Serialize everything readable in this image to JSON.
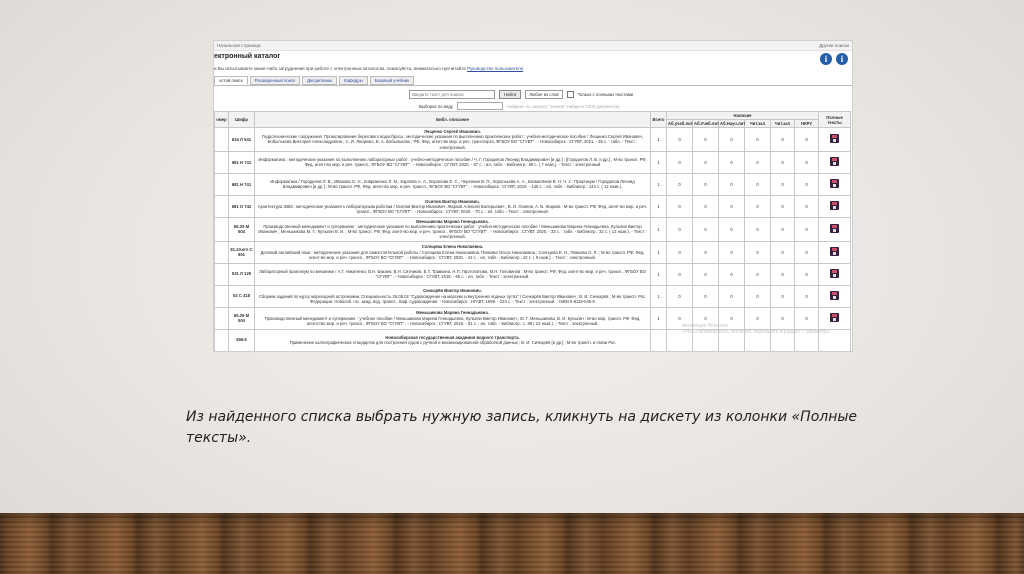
{
  "browser": {
    "page_label": "Начальная страница",
    "right_link": "Другие поиски"
  },
  "catalog": {
    "title": "ектронный каталог",
    "info_icon_label": "i",
    "notice_text": "и Вы испытываете какие-либо затруднения при работе с электронным каталогом, пожалуйста, внимательно прочитайте",
    "notice_link": "Руководство пользователя",
    "tabs": [
      "остой поиск",
      "Расширенный поиск",
      "Дисциплины",
      "Кафедры",
      "Базовый учебник"
    ],
    "search": {
      "placeholder": "Введите текст для поиска",
      "button": "Найти",
      "mode": "Любое из слов",
      "fulltext_label": "Только с полными текстами"
    },
    "filter": {
      "label": "Выборка по виду",
      "hint": "Найдено по запросу \"знания\" Найдено 1200 документов"
    },
    "table": {
      "headers": {
        "num": "омер",
        "shelf": "Шифр",
        "desc": "Библ. описание",
        "total": "Всего",
        "availability": "Наличие",
        "fulltext": "Полные тексты"
      },
      "sub_headers": [
        "Аб.учеб.лит",
        "Аб.Учеб.лит",
        "Аб.Науч.лит",
        "Чит.зал",
        "Чит.зал",
        "НКРУ"
      ],
      "rows": [
        {
          "shelf": "624 Л 541",
          "head": "Лещенко Сергей Иванович.",
          "text": "Гидротехнические сооружения. Проектирование берегового водосброса : методические указания по выполнению практических работ : учебно-методическое пособие / Лещенко Сергей Иванович, Бобылькова Виктория Александровна ; С. И. Лещенко, В. А. Бобылькова ; РФ, Фед. агент-во мор. и реч. транспорта, ФГБОУ ВО \"СГУВТ\" . - Новосибирск : СГУВТ, 2021. - 35 с. : табл. - Текст : электронный.",
          "total": "1",
          "counts": [
            "0",
            "0",
            "0",
            "0",
            "0",
            "0"
          ]
        },
        {
          "shelf": "681 Н 741",
          "head": "",
          "text": "Информатика : методические указания по выполнению лабораторных работ : учебно-методическое пособие / Ч. Г. Городилов Леонид Владимирович [и др.] ; [Городилов Л. В. и др.] ; М-во трансп. РФ, Фед. агент-во мор. и реч. трансп., ФГБОУ ВО \"СГУВТ\" . - Новосибирск : СГУВТ, 2020. - 67 с. : ил, табл. - Библиогр.: 86 с. ( 7 назв.). - Текст : электронный",
          "total": "1",
          "counts": [
            "0",
            "0",
            "0",
            "0",
            "0",
            "0"
          ]
        },
        {
          "shelf": "681 Н 741",
          "head": "",
          "text": "Информатика / Городилов Л. В., Иванова О. Н., Ковриженко Л. М., Карпова А. А., Воронова Е. С., Черепнин В. П., Королькова А. А., Безмолвнов В. Н. Ч. 2 : Практикум / Городилов Леонид Владимирович [и др.] ; М-во трансп. РФ, Фед. агент-во мор. и реч. трансп., ФГБОУ ВО \"СГУВТ\" . - Новосибирск : СГУВТ, 2019. - 145 с. : ил, табл. - Библиогр.: 144 с. ( 12 назв.).",
          "total": "1",
          "counts": [
            "0",
            "0",
            "0",
            "0",
            "0",
            "0"
          ]
        },
        {
          "shelf": "681 О 742",
          "head": "Осипов Виктор Иванович.",
          "text": "Архитектура ЭВМ : методические указания к лабораторным работам / Осипов Виктор Иванович, Жарков Алексей Валерьевич ; В. И. Осипов, А. В. Жарков ; М-во трансп. РФ, Фед. агент-во мор. и реч. трансп., ФГБОУ ВО \"СГУВТ\" . - Новосибирск : СГУВТ, 2020. - 70 с. : ил, табл. - Текст : электронный.",
          "total": "1",
          "counts": [
            "0",
            "0",
            "0",
            "0",
            "0",
            "0"
          ]
        },
        {
          "shelf": "65.29 М 504",
          "head": "Меньшикова Марина Геннадьевна.",
          "text": "Производственный менеджмент и супервизинг : методические указания по выполнению практических работ : учебно-методическое пособие / Меньшикова Марина Геннадьевна, Кулыгин Виктор Иванович ; Меньшикова М. Г., Кулыгин В. И. ; М-во трансп. РФ, Фед. агент-во мор. и реч. трансп., ФГБОУ ВО \"СГУВТ\" . - Новосибирск : СГУВТ, 2020. - 33 с. : табл. - Библиогр.: 32 с. ( 13 назв.). - Текст : электронный.",
          "total": "1",
          "counts": [
            "0",
            "0",
            "0",
            "0",
            "0",
            "0"
          ]
        },
        {
          "shelf": "81.2Англ С 601",
          "head": "Солнцева Елена Николаевна.",
          "text": "Деловой английский язык : методические указания для самостоятельной работы / Солнцева Елена Николаевна, Пинкова Ольга Николаевна ; Солнцева Е. Н., Пинкова О. Л. ; М-во трансп. РФ, Фед. агент-во мор. и реч. трансп., ФГБОУ ВО \"СГУВТ\" . - Новосибирск : СГУВТ, 2020. - 42 с. : ил, табл. - Библиогр.: 42 с. ( 9 назв.). - Текст : электронный.",
          "total": "1",
          "counts": [
            "0",
            "0",
            "0",
            "0",
            "0",
            "0"
          ]
        },
        {
          "shelf": "531 Л 125",
          "head": "",
          "text": "Лабораторный практикум по механике / А.Г. Никитенко, В.Н. Бакаев, В.Н. Ситников, Е.Т. Травкина, Н.П. Протопопова, М.Н. Головинов ; М-во трансп. РФ, Фед. агент-во мор. и реч. трансп., ФГБОУ ВО \"СГУВТ\" . - Новосибирск : СГУВТ, 2018. - 65 с. : ил, табл. - Текст : электронный.",
          "total": "1",
          "counts": [
            "0",
            "0",
            "0",
            "0",
            "0",
            "0"
          ]
        },
        {
          "shelf": "52 С 418",
          "head": "Сичкарёв Виктор Иванович.",
          "text": "Сборник заданий по курсу мореходной астрономии. Специальность 26.05.02 \"Судовождение на морских и внутренних водных путях\" / Сичкарёв Виктор Иванович ; В. И. Сичкарёв ; М-во трансп. Рос. Федерации, Новосиб. гос. акад. вод. трансп., Каф. судовождения. - Новосибирск : НГАВТ, 1999. - 223 с. - Текст : электронный. - ISBN 5-8119-045-6",
          "total": "1",
          "counts": [
            "0",
            "0",
            "0",
            "0",
            "0",
            "0"
          ]
        },
        {
          "shelf": "65.29 М 504",
          "head": "Меньшикова Марина Геннадьевна.",
          "text": "Производственный менеджмент и супервизинг : учебное пособие / Меньшикова Марина Геннадьевна, Кулыгин Виктор Иванович ; М. Г. Меньшикова, В. И. Кулыгин ; М-во мор. трансп. РФ, Фед. агентство мор. и реч. трансп., ФГБОУ ВО \"СГУВТ\" . - Новосибирск : СГУВТ, 2018. - 91 с. : ил, табл. - Библиогр.: с. 89 ( 22 назв.). - Текст : электронный.",
          "total": "1",
          "counts": [
            "0",
            "0",
            "0",
            "0",
            "0",
            "0"
          ]
        },
        {
          "shelf": "656.6",
          "head": "Новосибирская государственная академия водного транспорта.",
          "text": "Применение каллиграфических стандартов для построения судов с ручной и механизированной обработкой данных ; В. И. Сичкарёв [и др.] ; М-во трансп. и связи Рос",
          "total": "",
          "counts": [
            "",
            "",
            "",
            "",
            "",
            ""
          ]
        }
      ]
    },
    "watermark": [
      "Активация Windows",
      "Чтобы активировать Windows, перейдите в раздел \"Параметры\"."
    ]
  },
  "caption": "Из найденного списка выбрать нужную запись, кликнуть на дискету из колонки «Полные тексты»."
}
